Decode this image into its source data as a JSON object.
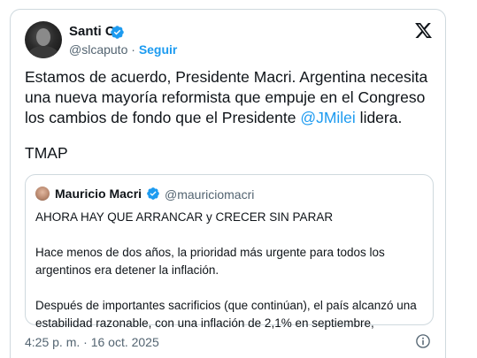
{
  "tweet": {
    "author_name": "Santi C.",
    "author_handle": "@slcaputo",
    "separator": " · ",
    "follow_label": "Seguir",
    "text_lines": [
      "Estamos de acuerdo, Presidente Macri. Argentina necesita",
      "una nueva mayoría reformista que empuje en el Congreso",
      "los cambios de fondo que el Presidente "
    ],
    "mention": "@JMilei",
    "text_line3_end": " lidera.",
    "signature": "TMAP",
    "timestamp": "4:25 p. m. · 16 oct. 2025"
  },
  "quote": {
    "author_name": "Mauricio Macri",
    "author_handle": "@mauriciomacri",
    "paragraph1": "AHORA HAY QUE ARRANCAR y CRECER SIN PARAR",
    "paragraph2_lines": [
      "Hace menos de dos años, la prioridad más urgente para todos los",
      "argentinos era detener la inflación."
    ],
    "paragraph3_lines": [
      "Después de importantes sacrificios (que continúan), el país alcanzó una",
      "estabilidad razonable, con una inflación de 2,1% en septiembre,"
    ]
  },
  "icons": {
    "verified": "verified-badge-icon",
    "x_logo": "x-logo-icon",
    "info": "info-icon"
  },
  "colors": {
    "accent": "#1d9bf0",
    "text": "#0f1419",
    "secondary": "#536471",
    "border": "#cfd9de"
  }
}
